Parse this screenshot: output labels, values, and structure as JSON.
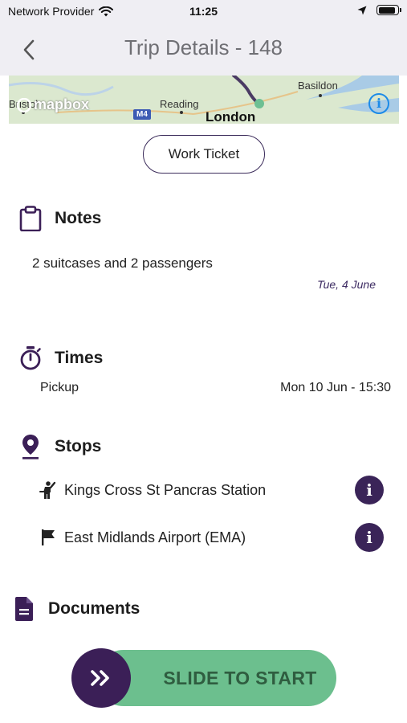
{
  "status_bar": {
    "carrier": "Network Provider",
    "time": "11:25",
    "battery_level": 0.9
  },
  "nav": {
    "title": "Trip Details - 148",
    "back_icon": "chevron-left-icon"
  },
  "map": {
    "labels": {
      "basildon": "Basildon",
      "reading": "Reading",
      "london": "London",
      "bristol": "Bristol",
      "logo": "mapbox",
      "m4": "M4"
    },
    "info_icon": "i"
  },
  "work_ticket_label": "Work Ticket",
  "notes": {
    "heading": "Notes",
    "text": "2 suitcases and 2 passengers",
    "date": "Tue, 4 June"
  },
  "times": {
    "heading": "Times",
    "pickup_label": "Pickup",
    "pickup_value": "Mon 10 Jun - 15:30"
  },
  "stops": {
    "heading": "Stops",
    "items": [
      {
        "name": "Kings Cross St Pancras Station",
        "icon": "person-hailing-icon"
      },
      {
        "name": "East Midlands Airport (EMA)",
        "icon": "flag-icon"
      }
    ],
    "info_icon_glyph": "i"
  },
  "documents": {
    "heading": "Documents"
  },
  "slider": {
    "label": "SLIDE TO START",
    "handle_glyph": "»"
  },
  "colors": {
    "accent": "#3b1f57",
    "slider_green": "#6cbf8e",
    "nav_bg": "#efeef3"
  }
}
